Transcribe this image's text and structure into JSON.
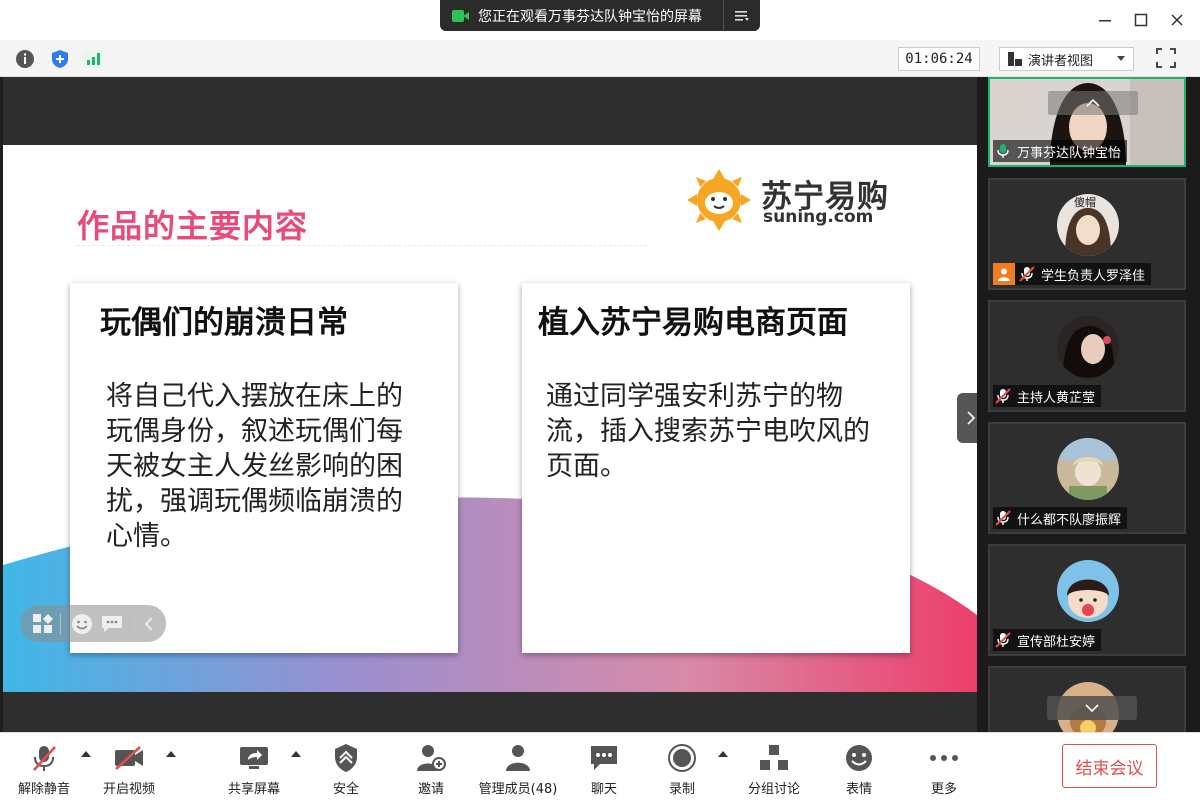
{
  "titlebar": {
    "share_banner_text": "您正在观看万事芬达队钟宝怡的屏幕"
  },
  "infobar": {
    "timer": "01:06:24",
    "view_mode": "演讲者视图"
  },
  "slide": {
    "title": "作品的主要内容",
    "logo_cn": "苏宁易购",
    "logo_en": "suning.com",
    "cards": [
      {
        "heading": "玩偶们的崩溃日常",
        "body": "将自己代入摆放在床上的玩偶身份，叙述玩偶们每天被女主人发丝影响的困扰，强调玩偶频临崩溃的心情。"
      },
      {
        "heading": "植入苏宁易购电商页面",
        "body": "通过同学强安利苏宁的物流，插入搜索苏宁电吹风的页面。"
      }
    ]
  },
  "participants": [
    {
      "name": "万事芬达队钟宝怡",
      "mic": "on",
      "active": true
    },
    {
      "name": "学生负责人罗泽佳",
      "mic": "muted",
      "host": true,
      "avatar_caption": "傻帽"
    },
    {
      "name": "主持人黄芷莹",
      "mic": "muted"
    },
    {
      "name": "什么都不队廖振辉",
      "mic": "muted"
    },
    {
      "name": "宣传部杜安婷",
      "mic": "muted"
    }
  ],
  "toolbar": {
    "unmute": "解除静音",
    "start_video": "开启视频",
    "share_screen": "共享屏幕",
    "security": "安全",
    "invite": "邀请",
    "manage_members": "管理成员(48)",
    "chat": "聊天",
    "record": "录制",
    "breakout": "分组讨论",
    "reactions": "表情",
    "more": "更多",
    "end_meeting": "结束会议"
  },
  "colors": {
    "accent_green": "#1eb46e",
    "title_pink": "#e84a7a",
    "end_red": "#e34d4d",
    "suning_orange": "#f5a623"
  }
}
